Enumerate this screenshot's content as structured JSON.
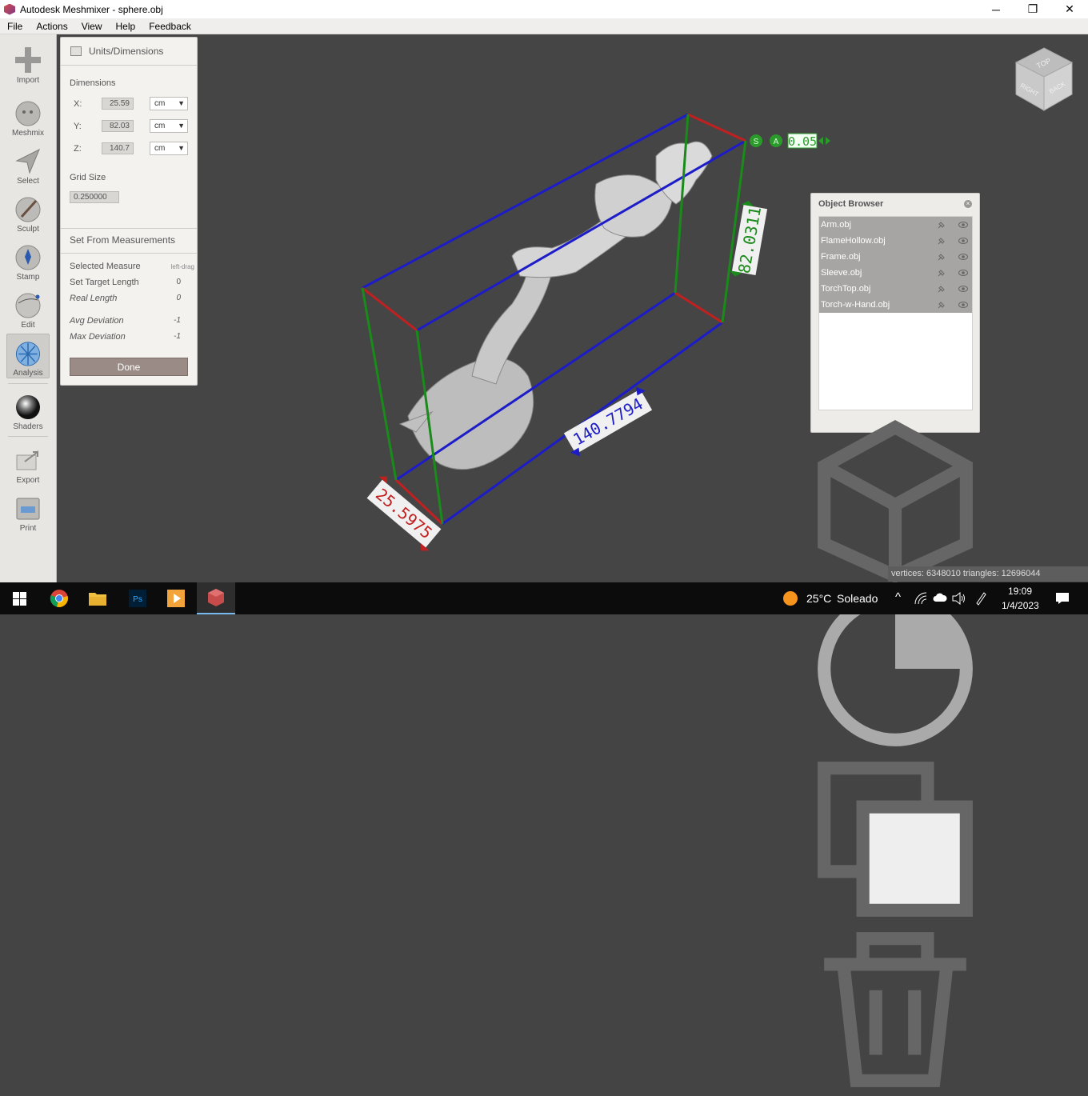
{
  "window": {
    "title": "Autodesk Meshmixer - sphere.obj",
    "minimize": "─",
    "maximize": "❐",
    "close": "✕"
  },
  "menu": [
    "File",
    "Actions",
    "View",
    "Help",
    "Feedback"
  ],
  "tools": [
    {
      "label": "Import",
      "icon": "plus-icon"
    },
    {
      "label": "Meshmix",
      "icon": "bunny-icon"
    },
    {
      "label": "Select",
      "icon": "cursor-icon"
    },
    {
      "label": "Sculpt",
      "icon": "brush-icon"
    },
    {
      "label": "Stamp",
      "icon": "stamp-icon"
    },
    {
      "label": "Edit",
      "icon": "edit-sphere-icon"
    },
    {
      "label": "Analysis",
      "icon": "analysis-icon",
      "active": true
    },
    {
      "label": "Shaders",
      "icon": "shader-sphere-icon"
    },
    {
      "label": "Export",
      "icon": "export-icon"
    },
    {
      "label": "Print",
      "icon": "printer-icon"
    }
  ],
  "panel": {
    "title": "Units/Dimensions",
    "dimensions_label": "Dimensions",
    "x": {
      "label": "X:",
      "value": "25.59",
      "unit": "cm"
    },
    "y": {
      "label": "Y:",
      "value": "82.03",
      "unit": "cm"
    },
    "z": {
      "label": "Z:",
      "value": "140.7",
      "unit": "cm"
    },
    "grid_label": "Grid Size",
    "grid_value": "0.250000",
    "section": "Set From Measurements",
    "selected_measure": {
      "label": "Selected Measure",
      "value": "left-drag"
    },
    "target_length": {
      "label": "Set Target Length",
      "value": "0"
    },
    "real_length": {
      "label": "Real Length",
      "value": "0"
    },
    "avg_dev": {
      "label": "Avg Deviation",
      "value": "-1"
    },
    "max_dev": {
      "label": "Max Deviation",
      "value": "-1"
    },
    "done": "Done"
  },
  "viewport": {
    "snap_s": "S",
    "snap_a": "A",
    "snap_value": "0.05",
    "dim_x": "25.5975",
    "dim_y": "82.0311",
    "dim_z": "140.7794",
    "viewcube": {
      "top": "TOP",
      "right": "RIGHT",
      "back": "BACK"
    },
    "colors": {
      "x_axis": "#c0201f",
      "y_axis": "#1a8a1a",
      "z_axis": "#1c1cc8"
    }
  },
  "object_browser": {
    "title": "Object Browser",
    "items": [
      "Arm.obj",
      "FlameHollow.obj",
      "Frame.obj",
      "Sleeve.obj",
      "TorchTop.obj",
      "Torch-w-Hand.obj"
    ]
  },
  "status": "vertices: 6348010 triangles: 12696044",
  "taskbar": {
    "weather_temp": "25°C",
    "weather_desc": "Soleado",
    "time": "19:09",
    "date": "1/4/2023"
  }
}
